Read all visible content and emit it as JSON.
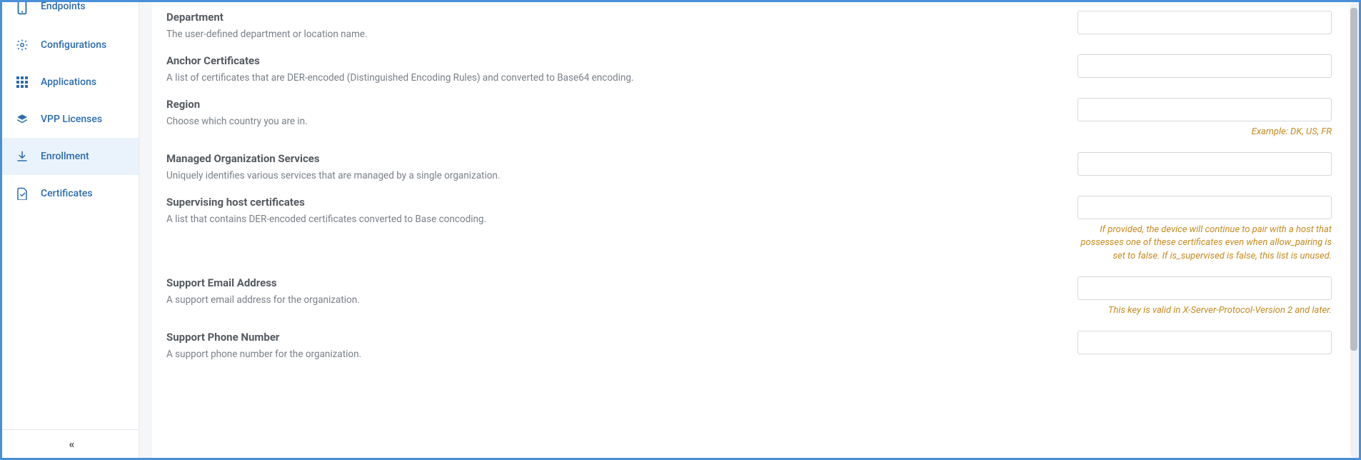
{
  "sidebar": {
    "items": [
      {
        "label": "Endpoints"
      },
      {
        "label": "Configurations"
      },
      {
        "label": "Applications"
      },
      {
        "label": "VPP Licenses"
      },
      {
        "label": "Enrollment"
      },
      {
        "label": "Certificates"
      }
    ]
  },
  "form": {
    "fields": [
      {
        "title": "Department",
        "desc": "The user-defined department or location name.",
        "value": "",
        "hint": ""
      },
      {
        "title": "Anchor Certificates",
        "desc": "A list of certificates that are DER-encoded (Distinguished Encoding Rules) and converted to Base64 encoding.",
        "value": "",
        "hint": ""
      },
      {
        "title": "Region",
        "desc": "Choose which country you are in.",
        "value": "",
        "hint": "Example: DK, US, FR"
      },
      {
        "title": "Managed Organization Services",
        "desc": "Uniquely identifies various services that are managed by a single organization.",
        "value": "",
        "hint": ""
      },
      {
        "title": "Supervising host certificates",
        "desc": "A list that contains DER-encoded certificates converted to Base concoding.",
        "value": "",
        "hint": "If provided, the device will continue to pair with a host that possesses one of these certificates even when allow_pairing is set to false. If is_supervised is false, this list is unused."
      },
      {
        "title": "Support Email Address",
        "desc": "A support email address for the organization.",
        "value": "",
        "hint": "This key is valid in X-Server-Protocol-Version 2 and later."
      },
      {
        "title": "Support Phone Number",
        "desc": "A support phone number for the organization.",
        "value": "",
        "hint": ""
      }
    ]
  }
}
